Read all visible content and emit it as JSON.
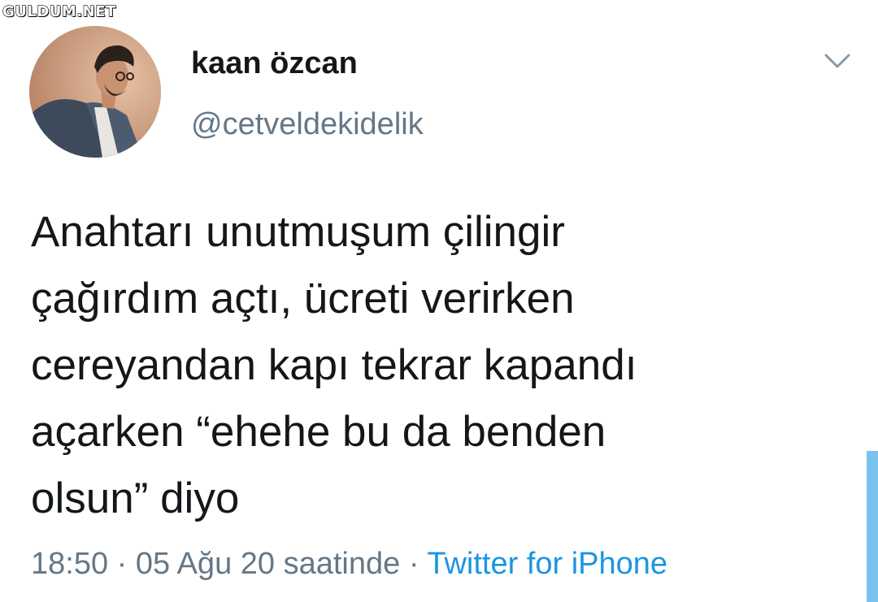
{
  "watermark": {
    "text": "GULDUM.NET"
  },
  "tweet": {
    "display_name": "kaan özcan",
    "handle": "@cetveldekidelik",
    "text": "Anahtarı unutmuşum çilingir\nçağırdım açtı, ücreti verirken\ncereyandan kapı tekrar kapandı\naçarken “ehehe bu da benden\nolsun” diyo",
    "timestamp": "18:50 · 05 Ağu 20 saatinde",
    "separator": " · ",
    "source": "Twitter for iPhone"
  },
  "colors": {
    "text": "#14171a",
    "secondary": "#657786",
    "link": "#1b95e0",
    "accent_bar": "#79c2f0"
  },
  "icons": {
    "menu": "chevron-down-icon",
    "avatar": "profile-photo"
  }
}
